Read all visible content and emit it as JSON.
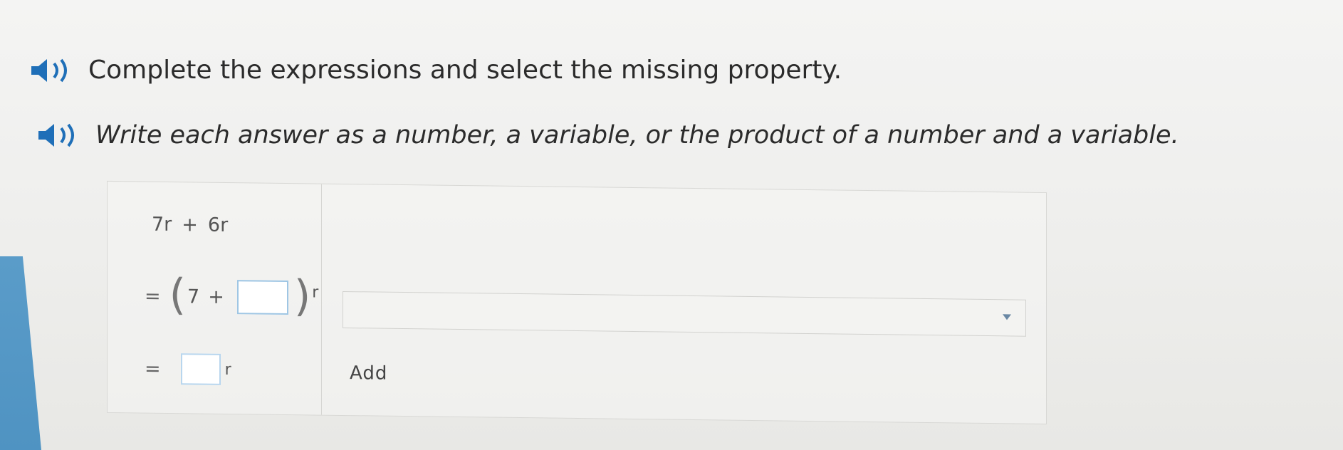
{
  "instructions": {
    "line1": "Complete the expressions and select the missing property.",
    "line2": "Write each answer as a number, a variable, or the product of a number and a variable."
  },
  "icons": {
    "audio": "speaker-icon"
  },
  "colors": {
    "accent": "#4f93c2",
    "answer_box_border": "#9fc6e4"
  },
  "problem": {
    "line1": {
      "term1": "7r",
      "operator": "+",
      "term2": "6r"
    },
    "line2": {
      "equals": "=",
      "open_paren": "(",
      "number": "7",
      "operator": "+",
      "answer_value": "",
      "close_paren": ")",
      "variable": "r"
    },
    "line3": {
      "equals": "=",
      "answer_value": "",
      "variable": "r"
    },
    "property_select": {
      "selected": ""
    },
    "property_line3": "Add"
  }
}
